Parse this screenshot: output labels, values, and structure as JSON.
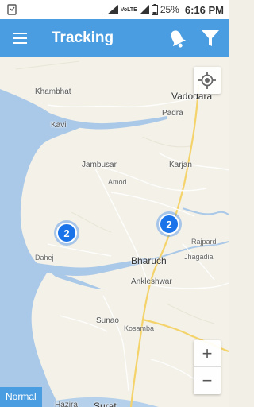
{
  "status_bar": {
    "volte": "VoLTE",
    "battery": "25%",
    "time": "6:16 PM"
  },
  "app_bar": {
    "title": "Tracking",
    "menu_icon": "hamburger-menu-icon",
    "bell_icon": "bell-icon",
    "filter_icon": "filter-icon",
    "color": "#4a9de0"
  },
  "map": {
    "places": {
      "vadodara": "Vadodara",
      "khambhat": "Khambhat",
      "padra": "Padra",
      "kavi": "Kavi",
      "jambusar": "Jambusar",
      "karjan": "Karjan",
      "amod": "Amod",
      "rajpardi": "Rajpardi",
      "dahej": "Dahej",
      "bharuch": "Bharuch",
      "jhagadia": "Jhagadia",
      "ankleshwar": "Ankleshwar",
      "sunao": "Sunao",
      "kosamba": "Kosamba",
      "hazira": "Hazira",
      "surat": "Surat"
    },
    "clusters": [
      {
        "count": "2",
        "color": "#1a73e8"
      },
      {
        "count": "2",
        "color": "#1a73e8"
      }
    ],
    "locate_icon": "my-location-icon",
    "zoom_in": "+",
    "zoom_out": "−",
    "map_type": "Normal",
    "water_color": "#aac8e8",
    "land_color": "#f3f1e8"
  }
}
